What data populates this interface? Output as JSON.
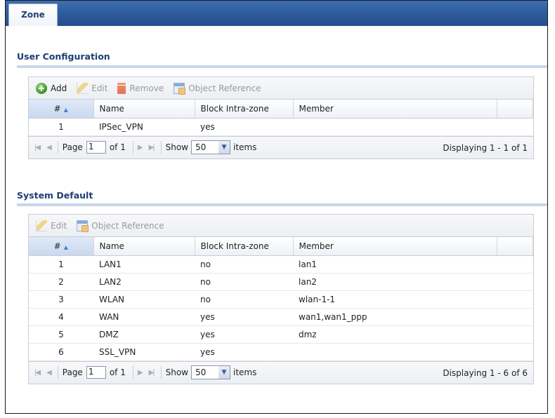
{
  "tab": {
    "label": "Zone"
  },
  "user_configuration": {
    "title": "User Configuration",
    "toolbar": {
      "add": "Add",
      "edit": "Edit",
      "remove": "Remove",
      "object_reference": "Object Reference"
    },
    "columns": [
      "#",
      "Name",
      "Block Intra-zone",
      "Member"
    ],
    "rows": [
      {
        "num": "1",
        "name": "IPSec_VPN",
        "block": "yes",
        "member": ""
      }
    ],
    "pager": {
      "page_label": "Page",
      "page_value": "1",
      "of_label": "of 1",
      "show_label": "Show",
      "show_value": "50",
      "items_label": "items",
      "display": "Displaying 1 - 1 of 1"
    }
  },
  "system_default": {
    "title": "System Default",
    "toolbar": {
      "edit": "Edit",
      "object_reference": "Object Reference"
    },
    "columns": [
      "#",
      "Name",
      "Block Intra-zone",
      "Member"
    ],
    "rows": [
      {
        "num": "1",
        "name": "LAN1",
        "block": "no",
        "member": "lan1"
      },
      {
        "num": "2",
        "name": "LAN2",
        "block": "no",
        "member": "lan2"
      },
      {
        "num": "3",
        "name": "WLAN",
        "block": "no",
        "member": "wlan-1-1"
      },
      {
        "num": "4",
        "name": "WAN",
        "block": "yes",
        "member": "wan1,wan1_ppp"
      },
      {
        "num": "5",
        "name": "DMZ",
        "block": "yes",
        "member": "dmz"
      },
      {
        "num": "6",
        "name": "SSL_VPN",
        "block": "yes",
        "member": ""
      }
    ],
    "pager": {
      "page_label": "Page",
      "page_value": "1",
      "of_label": "of 1",
      "show_label": "Show",
      "show_value": "50",
      "items_label": "items",
      "display": "Displaying 1 - 6 of 6"
    }
  }
}
